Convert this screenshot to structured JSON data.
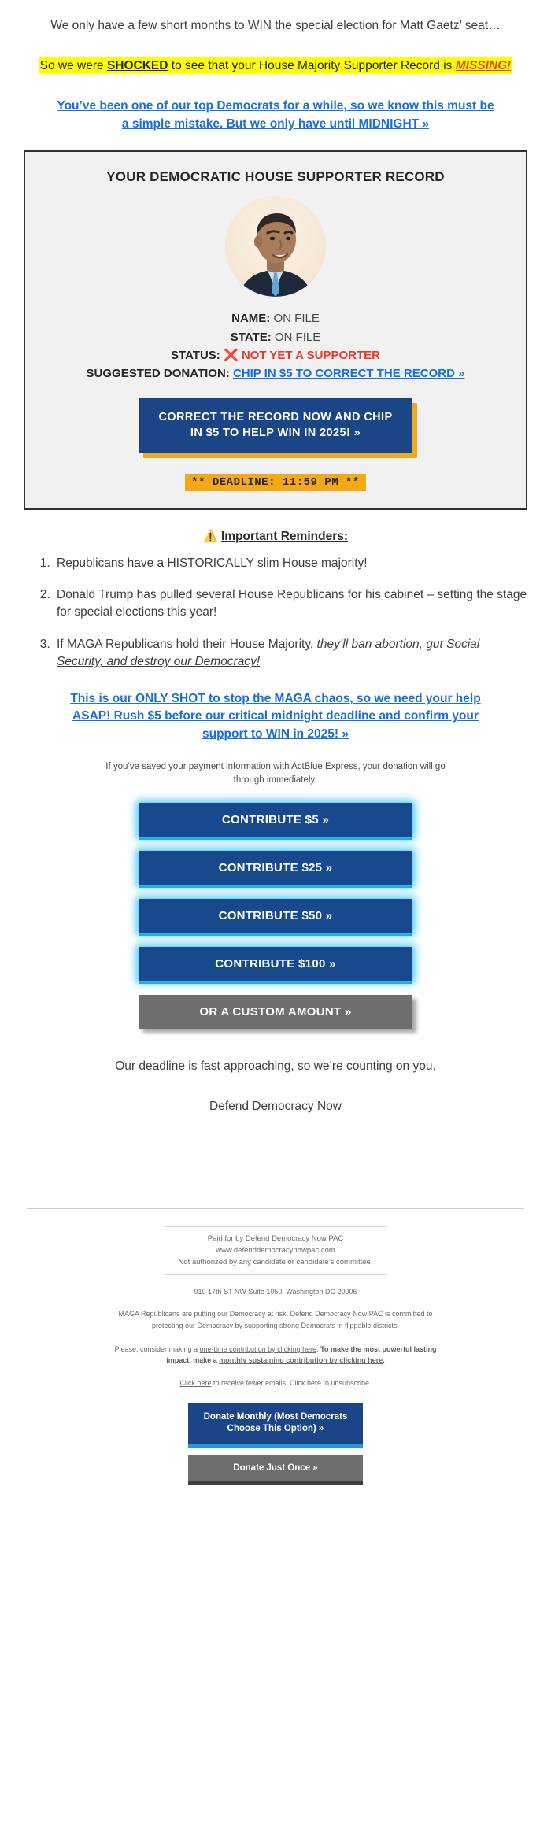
{
  "intro": {
    "lede": "We only have a few short months to WIN the special election for Matt Gaetz’ seat…",
    "shock_pre": "So we were ",
    "shock_word": "SHOCKED",
    "shock_mid": " to see that your House Majority Supporter Record is ",
    "shock_missing": "MISSING!",
    "blue_cta": "You’ve been one of our top Democrats for a while, so we know this must be a simple mistake. But we only have until MIDNIGHT »"
  },
  "card": {
    "title": "YOUR DEMOCRATIC HOUSE SUPPORTER RECORD",
    "photo_alt": "hakeem-jeffries-portrait",
    "rows": [
      {
        "label": "NAME:",
        "value": "ON FILE"
      },
      {
        "label": "STATE:",
        "value": "ON FILE"
      }
    ],
    "status_label": "STATUS:",
    "status_icon": "❌",
    "status_value": "NOT YET A SUPPORTER",
    "suggested_label": "SUGGESTED DONATION:",
    "suggested_link": "CHIP IN $5 TO CORRECT THE RECORD »",
    "cta_button": "CORRECT THE RECORD NOW AND CHIP IN $5 TO HELP WIN IN 2025! »",
    "deadline": "** DEADLINE: 11:59 PM **"
  },
  "reminders": {
    "heading_icon": "⚠️",
    "heading": "Important Reminders:",
    "items": [
      {
        "text": "Republicans have a HISTORICALLY slim House majority!",
        "emph": ""
      },
      {
        "text": "Donald Trump has pulled several House Republicans for his cabinet – setting the stage for special elections this year!",
        "emph": ""
      },
      {
        "pre": "If MAGA Republicans hold their House Majority, ",
        "emph": "they’ll ban abortion, gut Social Security, and destroy our Democracy!"
      }
    ]
  },
  "cta2": "This is our ONLY SHOT to stop the MAGA chaos, so we need your help ASAP! Rush $5 before our critical midnight deadline and confirm your support to WIN in 2025! »",
  "express_note": "If you’ve saved your payment information with ActBlue Express, your donation will go through immediately:",
  "donate_buttons": [
    {
      "label": "CONTRIBUTE $5 »",
      "style": "blue"
    },
    {
      "label": "CONTRIBUTE $25 »",
      "style": "blue"
    },
    {
      "label": "CONTRIBUTE $50 »",
      "style": "blue"
    },
    {
      "label": "CONTRIBUTE $100 »",
      "style": "blue"
    },
    {
      "label": "OR A CUSTOM AMOUNT »",
      "style": "gray"
    }
  ],
  "signoff": {
    "line": "Our deadline is fast approaching, so we’re counting on you,",
    "signature": "Defend Democracy Now"
  },
  "footer": {
    "paid_line1": "Paid for by Defend Democracy Now PAC",
    "paid_line2": "www.defenddemocracynowpac.com",
    "paid_line3": "Not authorized by any candidate or candidate’s committee.",
    "address": "910 17th ST NW Suite 1050, Washington DC 20006",
    "mission": "MAGA Republicans are putting our Democracy at risk. Defend Democracy Now PAC is committed to protecting our Democracy by supporting strong Democrats in flippable districts.",
    "ask_pre": "Please, consider making a ",
    "ask_link1": "one-time contribution by clicking here",
    "ask_mid": ". ",
    "ask_bold_pre": "To make the most powerful lasting impact, make a ",
    "ask_link2": "monthly sustaining contribution by clicking here",
    "ask_bold_post": ".",
    "unsub_link1": "Click here",
    "unsub_mid": " to receive fewer emails. Click here to unsubscribe.",
    "btn_monthly": "Donate Monthly (Most Democrats Choose This Option) »",
    "btn_once": "Donate Just Once »"
  },
  "colors": {
    "highlight": "#ffff00",
    "link_blue": "#1a6fd4",
    "navy": "#1b4586",
    "gold": "#f0a81e",
    "alert_red": "#e23b2a",
    "glow_cyan": "#3dc6ff",
    "gray_btn": "#6e6e6e"
  }
}
